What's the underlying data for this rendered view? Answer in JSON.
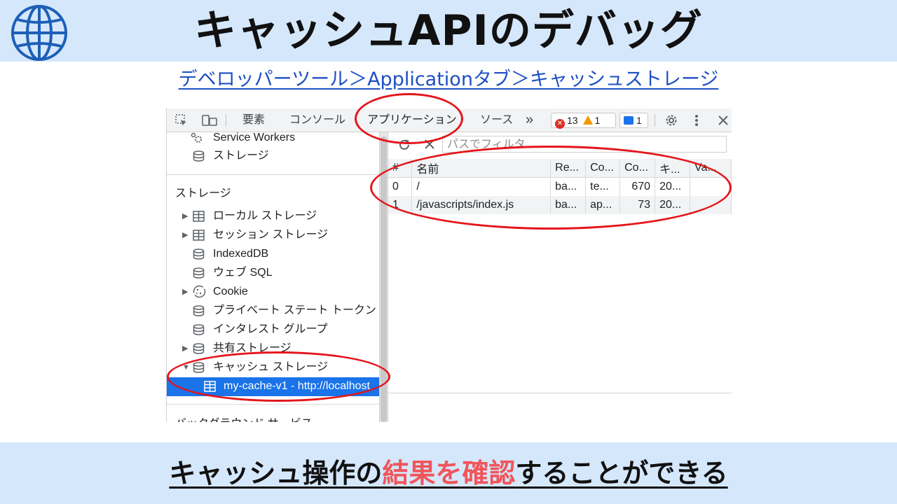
{
  "header": {
    "title": "キャッシュAPIのデバッグ",
    "icon": "globe-icon"
  },
  "breadcrumb": {
    "text": "デベロッパーツール＞Applicationタブ＞キャッシュストレージ"
  },
  "devtools": {
    "toolbar": {
      "tabs": [
        "要素",
        "コンソール",
        "アプリケーション",
        "ソース"
      ],
      "more": "»",
      "errors": "13",
      "warnings": "1",
      "messages": "1"
    },
    "sidebar": {
      "top_items": [
        {
          "label": "Service Workers",
          "icon": "gear-icon"
        },
        {
          "label": "ストレージ",
          "icon": "database-icon"
        }
      ],
      "section_title": "ストレージ",
      "items": [
        {
          "label": "ローカル ストレージ",
          "icon": "table-icon",
          "expandable": true
        },
        {
          "label": "セッション ストレージ",
          "icon": "table-icon",
          "expandable": true
        },
        {
          "label": "IndexedDB",
          "icon": "database-icon",
          "expandable": false
        },
        {
          "label": "ウェブ SQL",
          "icon": "database-icon",
          "expandable": false
        },
        {
          "label": "Cookie",
          "icon": "cookie-icon",
          "expandable": true
        },
        {
          "label": "プライベート ステート トークン",
          "icon": "database-icon",
          "expandable": false
        },
        {
          "label": "インタレスト グループ",
          "icon": "database-icon",
          "expandable": false
        },
        {
          "label": "共有ストレージ",
          "icon": "database-icon",
          "expandable": true
        },
        {
          "label": "キャッシュ ストレージ",
          "icon": "database-icon",
          "expandable": true
        }
      ],
      "selected_item": "my-cache-v1 - http://localhost",
      "next_section": "バックグラウンド サービス"
    },
    "cache_view": {
      "filter_placeholder": "パスでフィルタ",
      "columns": [
        "#",
        "名前",
        "Re...",
        "Co...",
        "Co...",
        "キ...",
        "Va..."
      ],
      "rows": [
        [
          "0",
          "/",
          "ba...",
          "te...",
          "670",
          "20...",
          ""
        ],
        [
          "1",
          "/javascripts/index.js",
          "ba...",
          "ap...",
          "73",
          "20...",
          ""
        ]
      ]
    }
  },
  "footer": {
    "text_before": "キャッシュ操作の",
    "highlight": "結果を確認",
    "text_after": "することができる",
    "highlight_color": "#f0555a"
  }
}
